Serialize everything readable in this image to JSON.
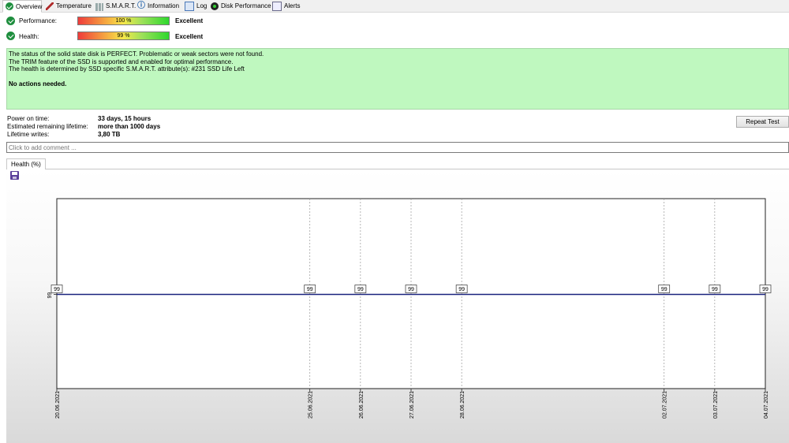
{
  "tabs": [
    {
      "label": "Overview",
      "icon": "check-circle-icon",
      "active": true
    },
    {
      "label": "Temperature",
      "icon": "thermometer-icon"
    },
    {
      "label": "S.M.A.R.T.",
      "icon": "smart-icon"
    },
    {
      "label": "Information",
      "icon": "info-icon"
    },
    {
      "label": "Log",
      "icon": "log-icon"
    },
    {
      "label": "Disk Performance",
      "icon": "disk-performance-icon"
    },
    {
      "label": "Alerts",
      "icon": "alerts-icon"
    }
  ],
  "performance": {
    "label": "Performance:",
    "value": "100 %",
    "verdict": "Excellent"
  },
  "health": {
    "label": "Health:",
    "value": "99 %",
    "verdict": "Excellent"
  },
  "status_lines": [
    "The status of the solid state disk is PERFECT. Problematic or weak sectors were not found.",
    "The TRIM feature of the SSD is supported and enabled for optimal performance.",
    "The health is determined by SSD specific S.M.A.R.T. attribute(s):  #231 SSD Life Left"
  ],
  "status_action": "No actions needed.",
  "info": [
    {
      "label": "Power on time:",
      "value": "33 days, 15 hours"
    },
    {
      "label": "Estimated remaining lifetime:",
      "value": "more than 1000 days"
    },
    {
      "label": "Lifetime writes:",
      "value": "3,80 TB"
    }
  ],
  "repeat_button": "Repeat Test",
  "comment_placeholder": "Click to add comment ...",
  "chart_tab": "Health (%)",
  "colors": {
    "status_bg": "#bff8bf",
    "series_line": "#1a237e"
  },
  "chart_data": {
    "type": "line",
    "title": "",
    "xlabel": "",
    "ylabel": "",
    "ytick": "99",
    "x": [
      "20.06.2021",
      "25.06.2021",
      "26.06.2021",
      "27.06.2021",
      "28.06.2021",
      "02.07.2021",
      "03.07.2021",
      "04.07.2021"
    ],
    "series": [
      {
        "values": [
          99,
          99,
          99,
          99,
          99,
          99,
          99,
          99
        ]
      }
    ]
  }
}
